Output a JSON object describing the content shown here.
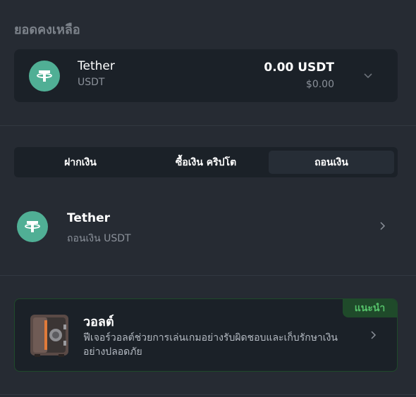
{
  "balance": {
    "section_title": "ยอดคงเหลือ",
    "coin_name": "Tether",
    "coin_symbol": "USDT",
    "amount": "0.00 USDT",
    "fiat_value": "$0.00",
    "coin_icon": "tether-icon",
    "expand_icon": "chevron-down-icon"
  },
  "tabs": [
    {
      "label": "ฝากเงิน",
      "active": false
    },
    {
      "label": "ซื้อเงิน คริปโต",
      "active": false
    },
    {
      "label": "ถอนเงิน",
      "active": true
    }
  ],
  "withdraw_option": {
    "name": "Tether",
    "subtitle": "ถอนเงิน USDT",
    "icon": "tether-icon",
    "arrow_icon": "chevron-right-icon"
  },
  "vault": {
    "badge": "แนะนำ",
    "title": "วอลต์",
    "description": "ฟีเจอร์วอลต์ช่วยการเล่นเกมอย่างรับผิดชอบและเก็บรักษาเงินอย่างปลอดภัย",
    "icon": "vault-safe-icon",
    "arrow_icon": "chevron-right-icon"
  },
  "colors": {
    "background": "#262b33",
    "card": "#1b2128",
    "tether_green": "#50af95",
    "badge_green": "#55c26a",
    "badge_bg": "#1f4a2a"
  }
}
